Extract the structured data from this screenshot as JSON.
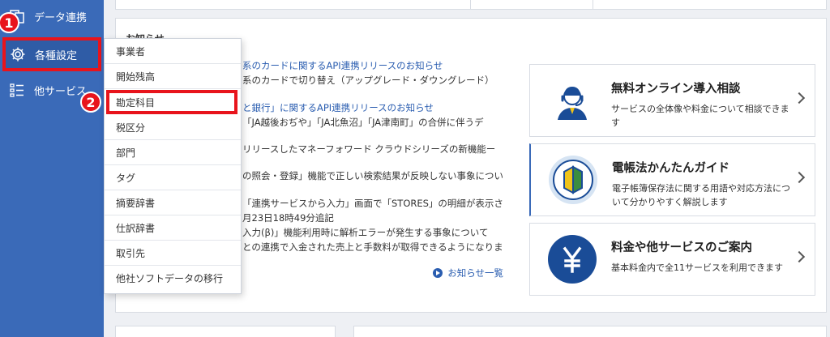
{
  "sidebar": {
    "items": [
      {
        "label": "データ連携",
        "icon": "data-link-icon"
      },
      {
        "label": "各種設定",
        "icon": "gear-icon"
      },
      {
        "label": "他サービス",
        "icon": "list-icon"
      }
    ]
  },
  "notice": {
    "title": "お知らせ",
    "lines": [
      "系のカードに関するAPI連携リリースのお知らせ",
      "系のカードで切り替え（アップグレード・ダウングレード）",
      "と銀行」に関するAPI連携リリースのお知らせ",
      "「JA越後おぢや」「JA北魚沼」「JA津南町」の合併に伴うデ",
      "リリースしたマネーフォワード クラウドシリーズの新機能ー",
      "の照会・登録」機能で正しい検索結果が反映しない事象につい",
      "「連携サービスから入力」画面で「STORES」の明細が表示さ",
      "月23日18時49分追記",
      "入力(β)」機能利用時に解析エラーが発生する事象について",
      "との連携で入金された売上と手数料が取得できるようになりま"
    ],
    "more_label": "お知らせ一覧"
  },
  "cards": [
    {
      "title": "無料オンライン導入相談",
      "desc": "サービスの全体像や料金について相談できます",
      "icon": "headset-support-icon"
    },
    {
      "title": "電帳法かんたんガイド",
      "desc": "電子帳簿保存法に関する用語や対応方法について分かりやすく解説します",
      "icon": "beginner-mark-icon"
    },
    {
      "title": "料金や他サービスのご案内",
      "desc": "基本料金内で全11サービスを利用できます",
      "icon": "yen-icon"
    }
  ],
  "dropdown": {
    "items": [
      "事業者",
      "開始残高",
      "勘定科目",
      "税区分",
      "部門",
      "タグ",
      "摘要辞書",
      "仕訳辞書",
      "取引先",
      "他社ソフトデータの移行"
    ],
    "selected_index": 2
  },
  "badges": {
    "one": "1",
    "two": "2"
  },
  "colors": {
    "sidebar": "#3a6ab8",
    "highlight": "#e8141c",
    "link": "#2a5db0"
  }
}
